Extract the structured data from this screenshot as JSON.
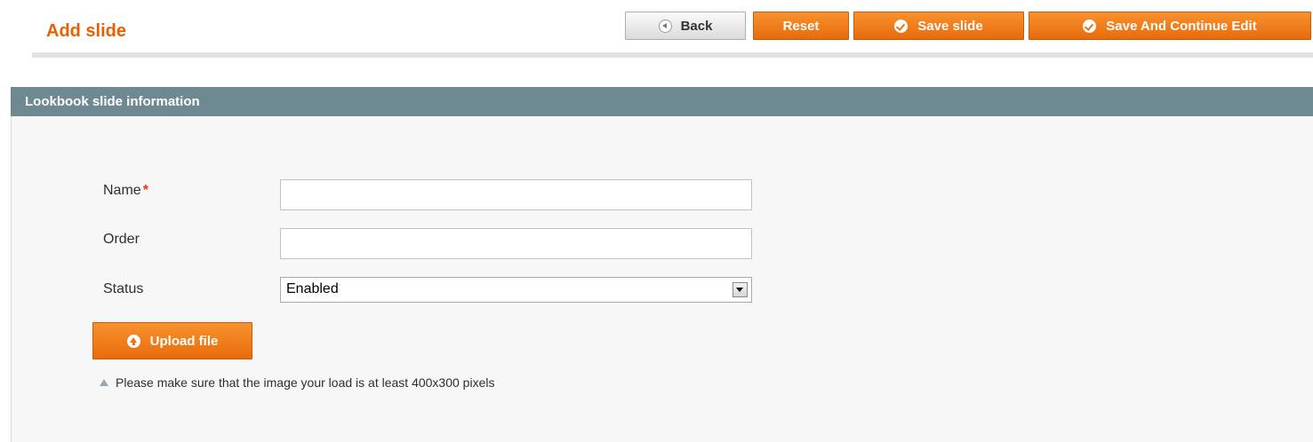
{
  "header": {
    "title": "Add slide"
  },
  "toolbar": {
    "back_label": "Back",
    "reset_label": "Reset",
    "save_label": "Save slide",
    "save_continue_label": "Save And Continue Edit"
  },
  "fieldset": {
    "title": "Lookbook slide information"
  },
  "form": {
    "name": {
      "label": "Name",
      "required_mark": "*",
      "value": ""
    },
    "order": {
      "label": "Order",
      "value": ""
    },
    "status": {
      "label": "Status",
      "selected": "Enabled"
    },
    "upload_label": "Upload file",
    "note": "Please make sure that the image your load is at least 400x300 pixels"
  },
  "icons": {
    "back": "back-arrow-icon",
    "check": "checkmark-icon",
    "upload": "upload-arrow-icon",
    "note": "triangle-note-icon",
    "dropdown": "chevron-down-icon"
  },
  "colors": {
    "accent": "#eb5e00",
    "button_orange": "#f08020",
    "fieldset_header": "#6f8992",
    "required": "#eb340a"
  }
}
